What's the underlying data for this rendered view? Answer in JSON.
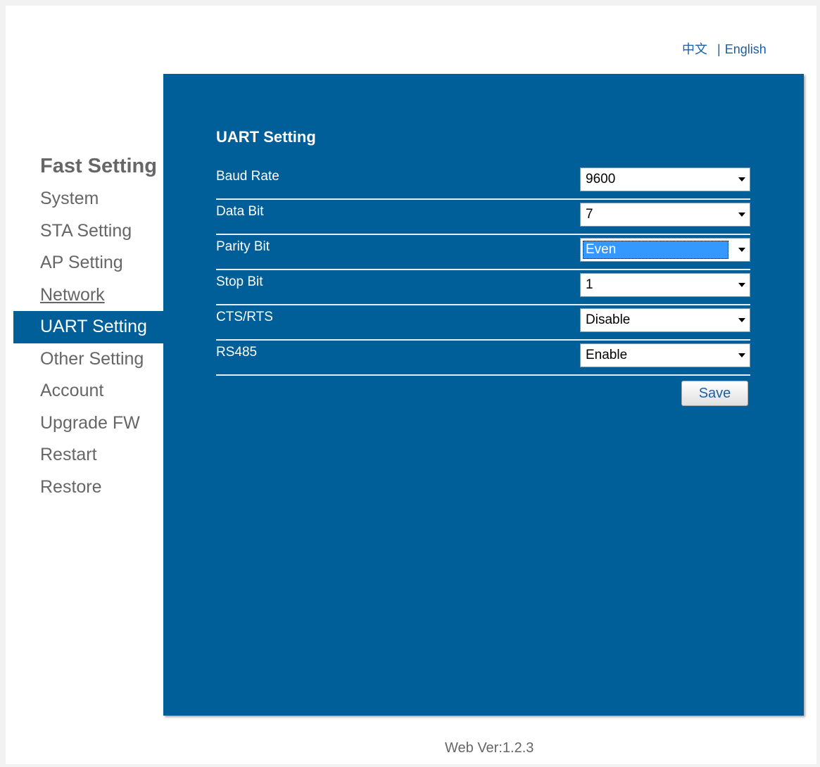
{
  "lang": {
    "chinese": "中文",
    "separator": "|",
    "english": "English"
  },
  "sidebar": {
    "title": "Fast Setting",
    "items": [
      {
        "label": "System"
      },
      {
        "label": "STA Setting"
      },
      {
        "label": "AP Setting"
      },
      {
        "label": "Network"
      },
      {
        "label": "UART Setting"
      },
      {
        "label": "Other Setting"
      },
      {
        "label": "Account"
      },
      {
        "label": "Upgrade FW"
      },
      {
        "label": "Restart"
      },
      {
        "label": "Restore"
      }
    ],
    "active": "UART Setting"
  },
  "panel": {
    "title": "UART Setting",
    "fields": [
      {
        "label": "Baud Rate",
        "value": "9600"
      },
      {
        "label": "Data Bit",
        "value": "7"
      },
      {
        "label": "Parity Bit",
        "value": "Even"
      },
      {
        "label": "Stop Bit",
        "value": "1"
      },
      {
        "label": "CTS/RTS",
        "value": "Disable"
      },
      {
        "label": "RS485",
        "value": "Enable"
      }
    ],
    "save_label": "Save"
  },
  "footer": {
    "version": "Web Ver:1.2.3"
  },
  "colors": {
    "panel_bg": "#005f98",
    "active_nav": "#005f98",
    "link": "#1a5fa8",
    "selection": "#3399ff"
  }
}
